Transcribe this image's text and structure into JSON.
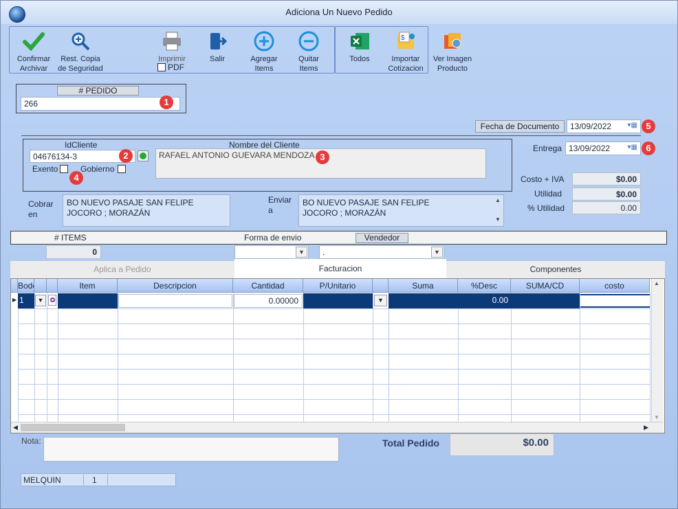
{
  "window": {
    "title": "Adiciona Un Nuevo Pedido"
  },
  "toolbar": {
    "confirm": "Confirmar\nArchivar",
    "restore": "Rest. Copia\nde Seguridad",
    "print": "Imprimir",
    "pdf": "PDF",
    "exit": "Salir",
    "add_items": "Agregar\nItems",
    "remove_items": "Quitar\nItems",
    "all": "Todos",
    "import_quote": "Importar\nCotizacion",
    "view_image": "Ver Imagen\nProducto"
  },
  "order": {
    "header": "# PEDIDO",
    "number": "266"
  },
  "badges": [
    "1",
    "2",
    "3",
    "4",
    "5",
    "6"
  ],
  "doc_date": {
    "label": "Fecha de  Documento",
    "value": "13/09/2022"
  },
  "delivery": {
    "label": "Entrega",
    "value": "13/09/2022"
  },
  "client": {
    "id_label": "IdCliente",
    "id_value": "04676134-3",
    "name_label": "Nombre del Cliente",
    "name_value": "RAFAEL ANTONIO GUEVARA MENDOZA",
    "exempt": "Exento",
    "government": "Gobierno"
  },
  "totals": {
    "cost_label": "Costo + IVA",
    "cost": "$0.00",
    "utility_label": "Utilidad",
    "utility": "$0.00",
    "pct_label": "% Utilidad",
    "pct": "0.00"
  },
  "billing": {
    "label": "Cobrar\nen",
    "value": "BO NUEVO PASAJE SAN FELIPE\nJOCORO ; MORAZÁN"
  },
  "shipping": {
    "label": "Enviar\na",
    "value": "BO NUEVO PASAJE SAN FELIPE\nJOCORO ; MORAZÁN"
  },
  "strip": {
    "items_label": "# ITEMS",
    "items": "0",
    "ship_label": "Forma de envio",
    "seller_label": "Vendedor",
    "seller_value": "."
  },
  "tabs": [
    "Aplica a Pedido",
    "Facturacion",
    "Componentes"
  ],
  "grid": {
    "columns": [
      "Bodega",
      "",
      "",
      "Item",
      "Descripcion",
      "Cantidad",
      "P/Unitario",
      "",
      "Suma",
      "%Desc",
      "SUMA/CD",
      "costo"
    ],
    "row": {
      "bodega": "1",
      "cantidad": "0.00000",
      "desc": "0.00"
    }
  },
  "footer": {
    "note_label": "Nota:",
    "total_label": "Total Pedido",
    "total": "$0.00",
    "user": "MELQUIN",
    "session": "1"
  }
}
